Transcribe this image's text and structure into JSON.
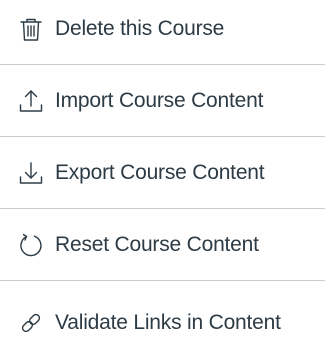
{
  "menu": {
    "items": [
      {
        "label": "Delete this Course",
        "icon": "trash-icon"
      },
      {
        "label": "Import Course Content",
        "icon": "upload-icon"
      },
      {
        "label": "Export Course Content",
        "icon": "download-icon"
      },
      {
        "label": "Reset Course Content",
        "icon": "reset-icon"
      },
      {
        "label": "Validate Links in Content",
        "icon": "link-icon"
      }
    ]
  },
  "colors": {
    "text": "#2d3b45",
    "divider": "#c7cdd1",
    "background": "#ffffff"
  }
}
